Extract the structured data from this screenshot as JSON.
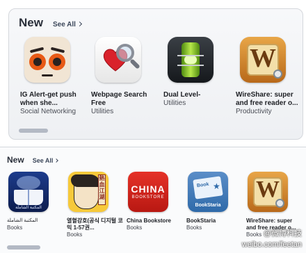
{
  "section_large": {
    "title": "New",
    "see_all": "See All",
    "apps": [
      {
        "name": "IG Alert-get push when she...",
        "category": "Social Networking",
        "icon": "cartoon-eyes-icon"
      },
      {
        "name": "Webpage Search Free",
        "category": "Utilities",
        "icon": "heart-magnifier-icon"
      },
      {
        "name": "Dual Level-",
        "category": "Utilities",
        "icon": "spirit-level-icon"
      },
      {
        "name": "WireShare: super and free reader o...",
        "category": "Productivity",
        "icon": "letter-w-tile-icon"
      }
    ]
  },
  "section_small": {
    "title": "New",
    "see_all": "See All",
    "apps": [
      {
        "name": "المكتبة الشاملة",
        "category": "Books",
        "icon": "open-book-icon",
        "icon_text": "المكتبة الشاملة"
      },
      {
        "name": "열혈강호(공식 디지털 코믹 1-57권...",
        "category": "Books",
        "icon": "manga-hero-icon",
        "icon_text": "熱血江湖"
      },
      {
        "name": "China Bookstore",
        "category": "Books",
        "icon": "china-bookstore-icon",
        "icon_text": "CHINA",
        "icon_subtext": "BOOKSTORE"
      },
      {
        "name": "BookStaria",
        "category": "Books",
        "icon": "bookstaria-icon",
        "icon_text": "BookStaria",
        "icon_panel_text": "Book"
      },
      {
        "name": "WireShare: super and free reader o...",
        "category": "Books",
        "icon": "letter-w-tile-icon"
      }
    ]
  },
  "icons": {
    "wire_letter": "W"
  },
  "watermark": {
    "line1": "@微博科技",
    "line2": "weibo.com/feetan"
  }
}
